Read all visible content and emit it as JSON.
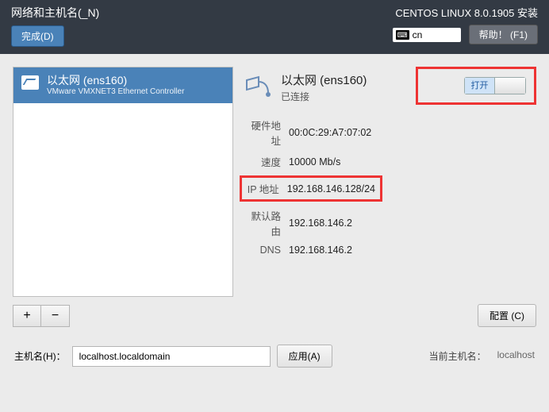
{
  "header": {
    "title": "网络和主机名(_N)",
    "done": "完成(D)",
    "distro": "CENTOS LINUX 8.0.1905 安装",
    "keyboard": "cn",
    "help": "帮助！ (F1)"
  },
  "network_list": {
    "item": {
      "name": "以太网 (ens160)",
      "sub": "VMware VMXNET3 Ethernet Controller"
    },
    "add": "+",
    "remove": "−"
  },
  "interface": {
    "name": "以太网 (ens160)",
    "status": "已连接",
    "toggle_on": "打开"
  },
  "details": {
    "hw_label": "硬件地址",
    "hw_value": "00:0C:29:A7:07:02",
    "speed_label": "速度",
    "speed_value": "10000 Mb/s",
    "ip_label": "IP 地址",
    "ip_value": "192.168.146.128/24",
    "gw_label": "默认路由",
    "gw_value": "192.168.146.2",
    "dns_label": "DNS",
    "dns_value": "192.168.146.2"
  },
  "config_btn": "配置 (C)",
  "hostname": {
    "label": "主机名(H)：",
    "value": "localhost.localdomain",
    "apply": "应用(A)",
    "current_label": "当前主机名：",
    "current_value": "localhost"
  }
}
